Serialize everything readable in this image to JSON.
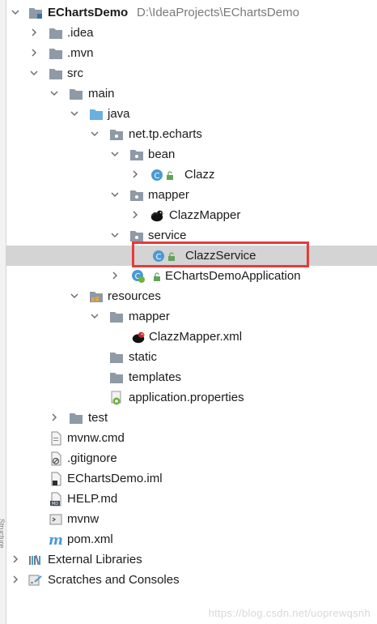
{
  "project": {
    "name": "EChartsDemo",
    "path": "D:\\IdeaProjects\\EChartsDemo"
  },
  "tree": {
    "idea": ".idea",
    "mvn": ".mvn",
    "src": "src",
    "main": "main",
    "java": "java",
    "package": "net.tp.echarts",
    "bean": "bean",
    "clazz": "Clazz",
    "mapper": "mapper",
    "clazz_mapper": "ClazzMapper",
    "service": "service",
    "clazz_service": "ClazzService",
    "app": "EChartsDemoApplication",
    "resources": "resources",
    "res_mapper": "mapper",
    "clazz_mapper_xml": "ClazzMapper.xml",
    "static": "static",
    "templates": "templates",
    "app_props": "application.properties",
    "test": "test",
    "mvnw_cmd": "mvnw.cmd",
    "gitignore": ".gitignore",
    "iml": "EChartsDemo.iml",
    "help": "HELP.md",
    "mvnw": "mvnw",
    "pom": "pom.xml",
    "external_libraries": "External Libraries",
    "scratches": "Scratches and Consoles"
  },
  "selected_item": "ClazzService",
  "colors": {
    "selection": "#d4d4d4",
    "highlight_border": "#e83a3a",
    "folder": "#8e9aa6",
    "source_folder": "#6ab0de",
    "class_icon": "#4a9ad4",
    "lock": "#63a35c"
  },
  "watermark": "https://blog.csdn.net/uoprewqsnh"
}
